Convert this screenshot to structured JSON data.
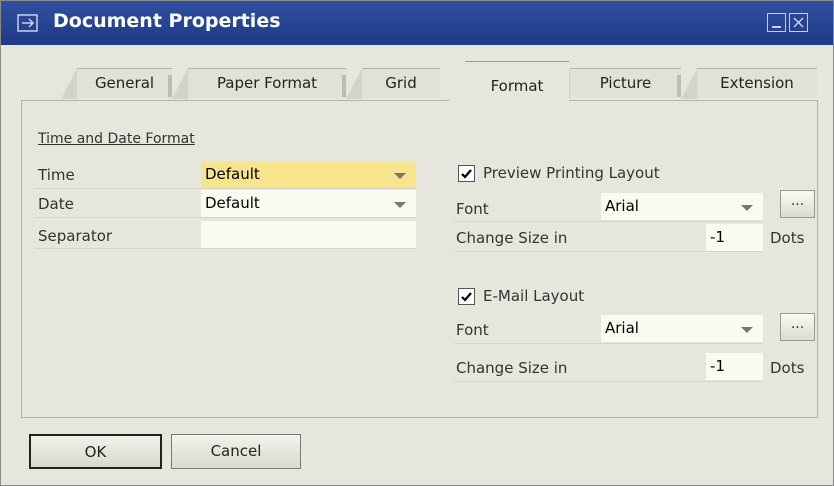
{
  "window": {
    "title": "Document Properties",
    "title_icon": "document-properties-icon"
  },
  "tabs": [
    {
      "label": "General",
      "active": false
    },
    {
      "label": "Paper Format",
      "active": false
    },
    {
      "label": "Grid",
      "active": false
    },
    {
      "label": "Format",
      "active": true
    },
    {
      "label": "Picture",
      "active": false
    },
    {
      "label": "Extension",
      "active": false
    }
  ],
  "left": {
    "section_title": "Time and Date Format",
    "time_label": "Time",
    "time_value": "Default",
    "date_label": "Date",
    "date_value": "Default",
    "separator_label": "Separator",
    "separator_value": ""
  },
  "preview": {
    "checkbox_label": "Preview Printing Layout",
    "checked": true,
    "font_label": "Font",
    "font_value": "Arial",
    "browse_label": "...",
    "size_label": "Change Size in",
    "size_value": "-1",
    "unit": "Dots"
  },
  "email": {
    "checkbox_label": "E-Mail Layout",
    "checked": true,
    "font_label": "Font",
    "font_value": "Arial",
    "browse_label": "...",
    "size_label": "Change Size in",
    "size_value": "-1",
    "unit": "Dots"
  },
  "buttons": {
    "ok": "OK",
    "cancel": "Cancel"
  },
  "colors": {
    "titlebar": "#2a4a9c",
    "highlight_field": "#f6e58c",
    "dialog_bg": "#e7e6dc"
  }
}
